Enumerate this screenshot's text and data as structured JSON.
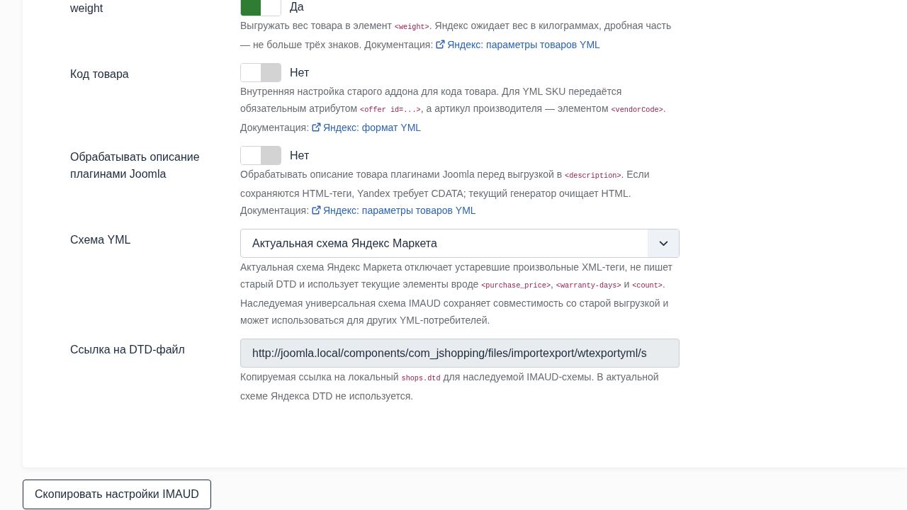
{
  "settings": [
    {
      "kind": "toggle",
      "label": "weight",
      "on": true,
      "state_text": "Да",
      "description": [
        {
          "kind": "text",
          "text": "Выгружать вес товара в элемент "
        },
        {
          "kind": "code",
          "text": "<weight>"
        },
        {
          "kind": "text",
          "text": ". Яндекс ожидает вес в килограммах, дробная часть — не больше трёх знаков. Документация: "
        },
        {
          "kind": "link",
          "text": "Яндекс: параметры товаров YML"
        }
      ]
    },
    {
      "kind": "toggle",
      "label": "Код товара",
      "on": false,
      "state_text": "Нет",
      "description": [
        {
          "kind": "text",
          "text": "Внутренняя настройка старого аддона для кода товара. Для YML SKU передаётся обязательным атрибутом "
        },
        {
          "kind": "code",
          "text": "<offer id=...>"
        },
        {
          "kind": "text",
          "text": ", а артикул производителя — элементом "
        },
        {
          "kind": "code",
          "text": "<vendorCode>"
        },
        {
          "kind": "text",
          "text": ". Документация: "
        },
        {
          "kind": "link",
          "text": "Яндекс: формат YML"
        }
      ]
    },
    {
      "kind": "toggle",
      "label": "Обрабатывать описание плагинами Joomla",
      "on": false,
      "state_text": "Нет",
      "description": [
        {
          "kind": "text",
          "text": "Обрабатывать описание товара плагинами Joomla перед выгрузкой в "
        },
        {
          "kind": "code",
          "text": "<description>"
        },
        {
          "kind": "text",
          "text": ". Если сохраняются HTML-теги, Yandex требует CDATA; текущий генератор очищает HTML. Документация: "
        },
        {
          "kind": "link",
          "text": "Яндекс: параметры товаров YML"
        }
      ]
    },
    {
      "kind": "select",
      "label": "Схема YML",
      "value": "Актуальная схема Яндекс Маркета",
      "description": [
        {
          "kind": "text",
          "text": "Актуальная схема Яндекс Маркета отключает устаревшие произвольные XML-теги, не пишет старый DTD и использует текущие элементы вроде "
        },
        {
          "kind": "code",
          "text": "<purchase_price>"
        },
        {
          "kind": "text",
          "text": ", "
        },
        {
          "kind": "code",
          "text": "<warranty-days>"
        },
        {
          "kind": "text",
          "text": " и "
        },
        {
          "kind": "code",
          "text": "<count>"
        },
        {
          "kind": "text",
          "text": ". Наследуемая универсальная схема IMAUD сохраняет совместимость со старой выгрузкой и может использоваться для других YML-потребителей."
        }
      ]
    },
    {
      "kind": "text_input",
      "label": "Ссылка на DTD-файл",
      "readonly": true,
      "value": "http://joomla.local/components/com_jshopping/files/importexport/wtexportyml/s",
      "description": [
        {
          "kind": "text",
          "text": "Копируемая ссылка на локальный "
        },
        {
          "kind": "code",
          "text": "shops.dtd"
        },
        {
          "kind": "text",
          "text": " для наследуемой IMAUD-схемы. В актуальной схеме Яндекса DTD не используется."
        }
      ]
    }
  ],
  "buttons": [
    {
      "label": "Скопировать настройки IMAUD"
    }
  ]
}
